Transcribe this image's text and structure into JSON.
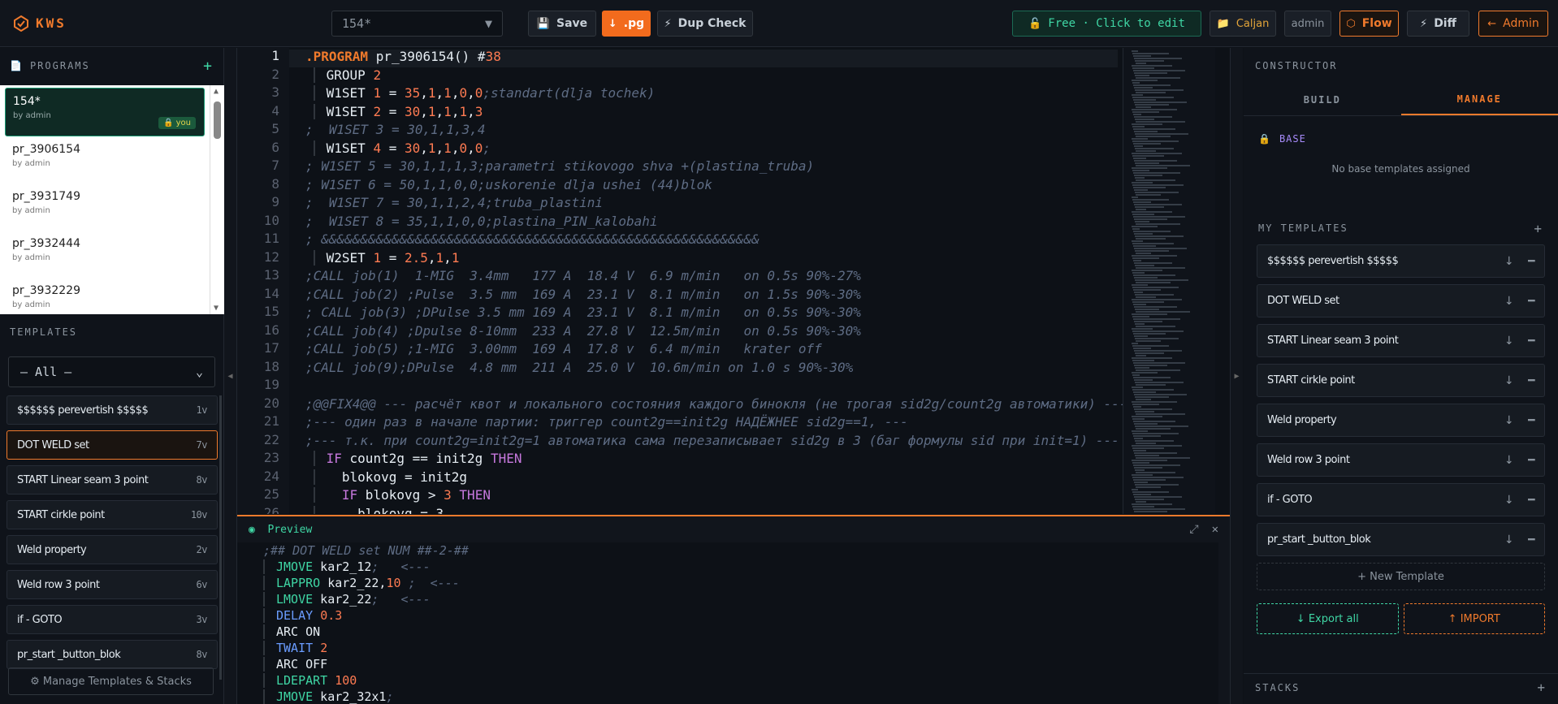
{
  "app": {
    "name": "KWS"
  },
  "toolbar": {
    "program_select": "154*",
    "save": "Save",
    "export_pg": ".pg",
    "dup_check": "Dup Check",
    "free": "Free · Click to edit",
    "user": "Caljan",
    "role": "admin",
    "flow": "Flow",
    "diff": "Diff",
    "admin": "Admin"
  },
  "programs": {
    "title": "PROGRAMS",
    "items": [
      {
        "name": "154*",
        "by": "by admin",
        "badge": "you"
      },
      {
        "name": "pr_3906154",
        "by": "by admin"
      },
      {
        "name": "pr_3931749",
        "by": "by admin"
      },
      {
        "name": "pr_3932444",
        "by": "by admin"
      },
      {
        "name": "pr_3932229",
        "by": "by admin"
      }
    ]
  },
  "templates": {
    "title": "TEMPLATES",
    "filter": "— All —",
    "items": [
      {
        "name": "$$$$$$ perevertish $$$$$",
        "v": "1v"
      },
      {
        "name": "DOT WELD set",
        "v": "7v"
      },
      {
        "name": "START Linear seam 3 point",
        "v": "8v"
      },
      {
        "name": "START cirkle point",
        "v": "10v"
      },
      {
        "name": "Weld property",
        "v": "2v"
      },
      {
        "name": "Weld row 3 point",
        "v": "6v"
      },
      {
        "name": "if - GOTO",
        "v": "3v"
      },
      {
        "name": "pr_start _button_blok",
        "v": "8v"
      }
    ],
    "manage": "Manage Templates & Stacks"
  },
  "editor": {
    "line_numbers": [
      "1",
      "2",
      "3",
      "4",
      "5",
      "6",
      "7",
      "8",
      "9",
      "10",
      "11",
      "12",
      "13",
      "14",
      "15",
      "16",
      "17",
      "18",
      "19",
      "20",
      "21",
      "22",
      "23",
      "24",
      "25",
      "26"
    ]
  },
  "preview": {
    "title": "Preview"
  },
  "constructor": {
    "title": "CONSTRUCTOR",
    "tab_build": "BUILD",
    "tab_manage": "MANAGE",
    "base_title": "BASE",
    "no_base": "No base templates assigned",
    "my_templates_title": "MY TEMPLATES",
    "my_templates": [
      "$$$$$$ perevertish $$$$$",
      "DOT WELD set",
      "START Linear seam 3 point",
      "START cirkle point",
      "Weld property",
      "Weld row 3 point",
      "if - GOTO",
      "pr_start _button_blok"
    ],
    "new_template": "New Template",
    "export_all": "Export all",
    "import": "IMPORT",
    "stacks_title": "STACKS"
  }
}
